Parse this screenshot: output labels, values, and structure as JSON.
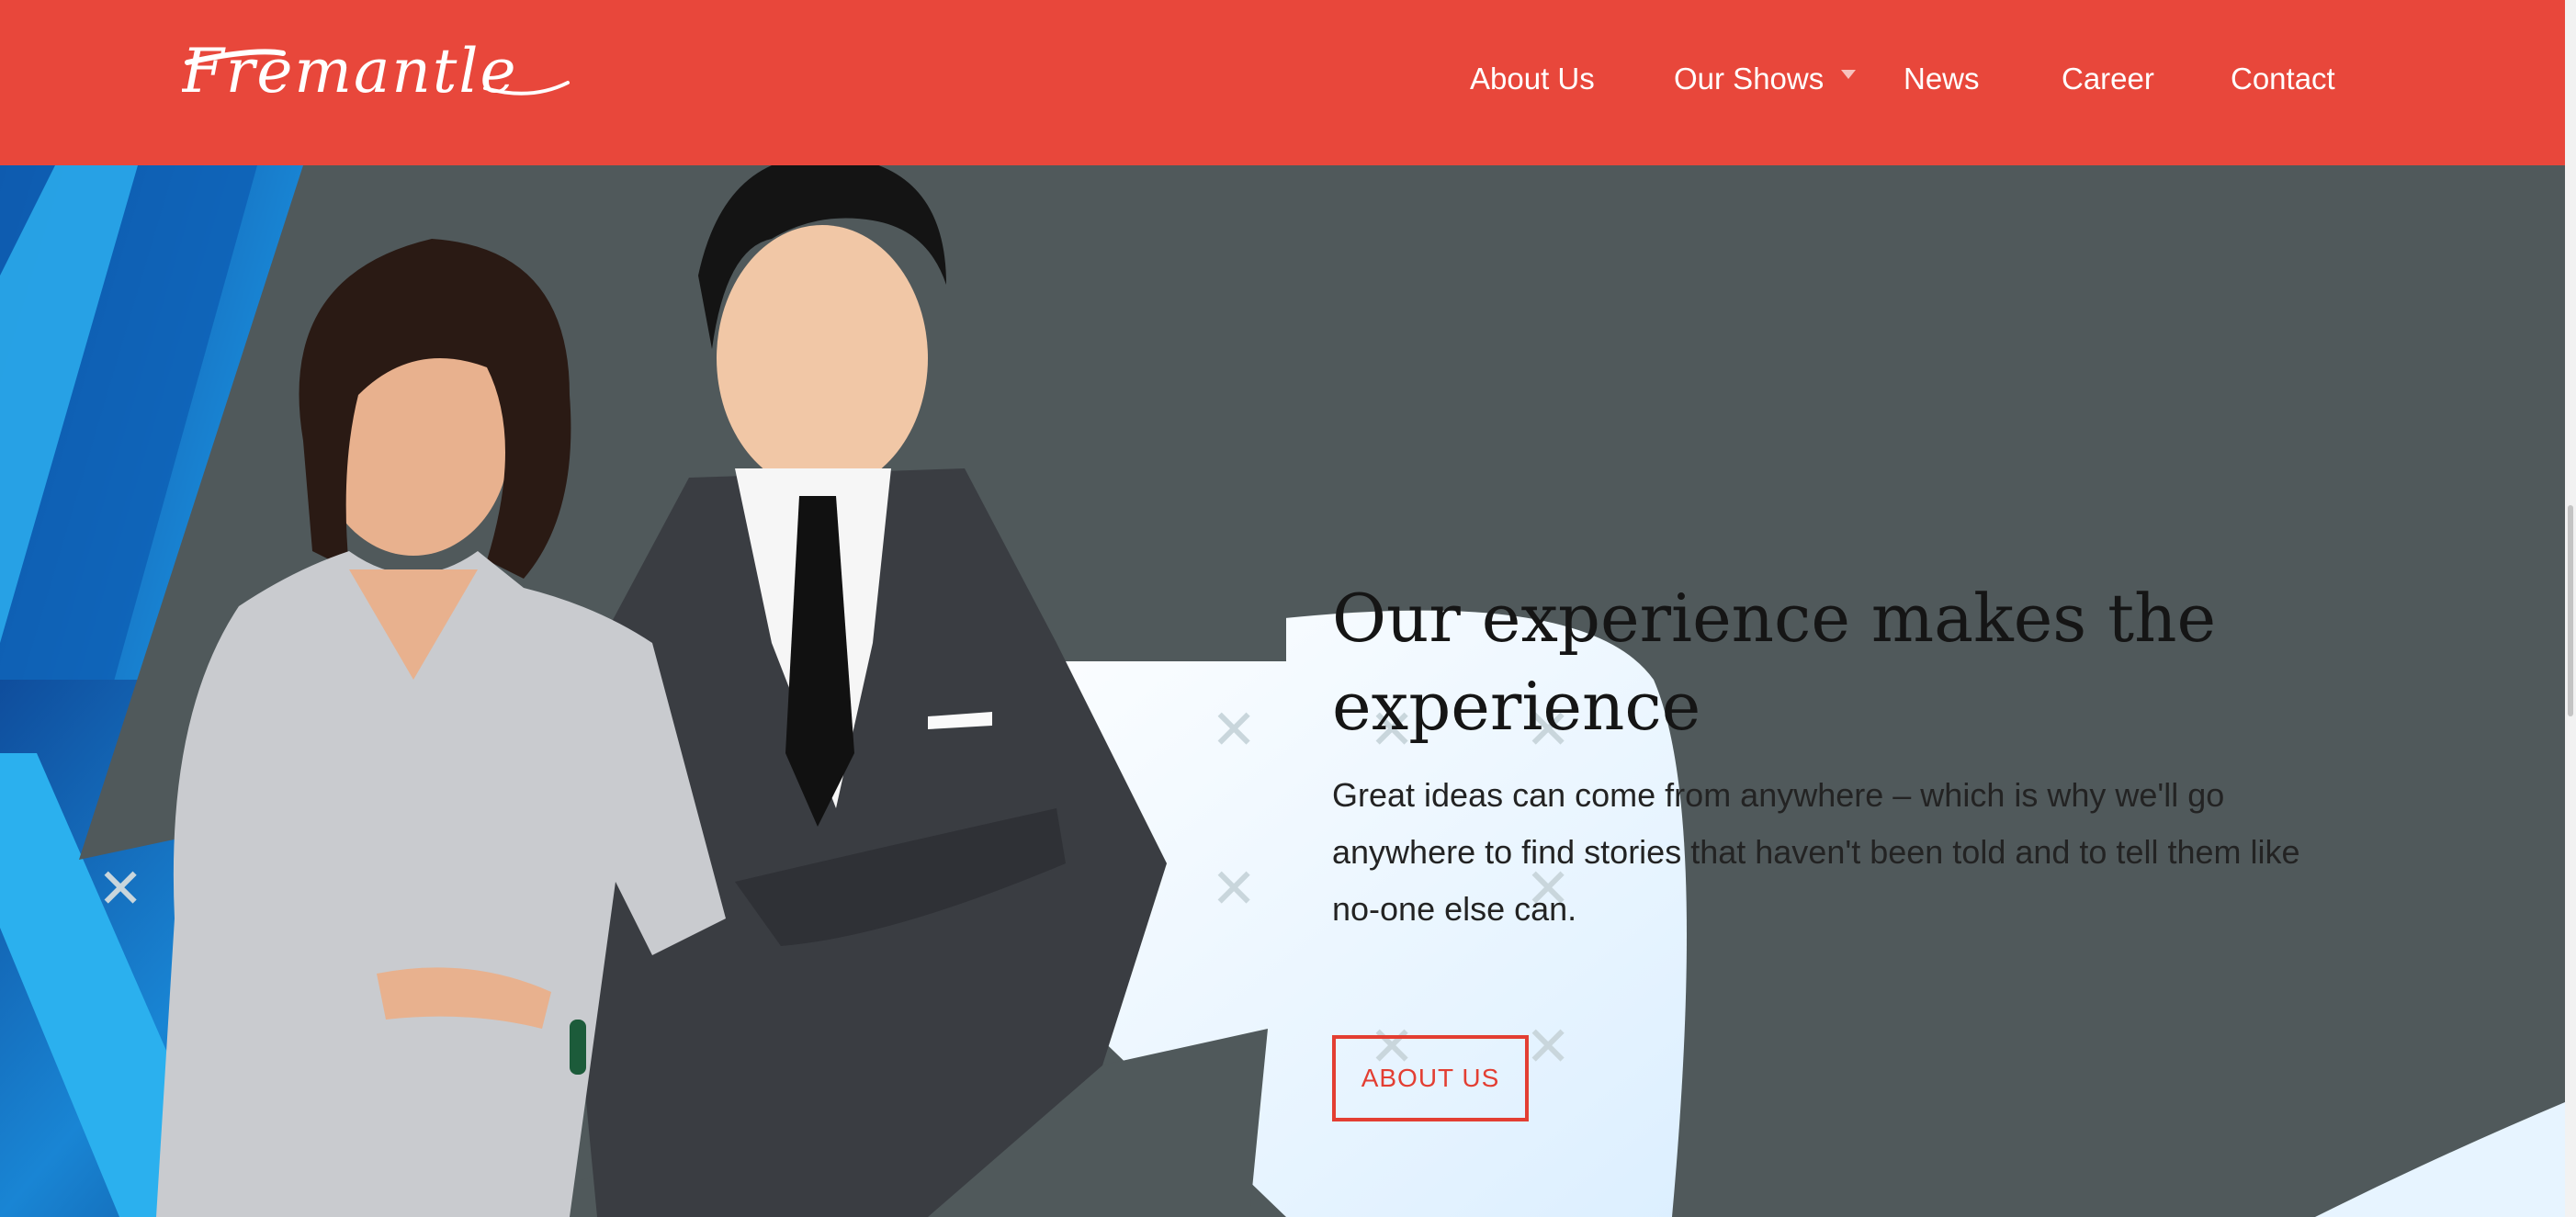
{
  "header": {
    "logo_text": "Fremantle",
    "nav": [
      {
        "label": "About Us"
      },
      {
        "label": "Our Shows"
      },
      {
        "label": "News"
      },
      {
        "label": "Career"
      },
      {
        "label": "Contact"
      }
    ]
  },
  "hero": {
    "headline": "Our experience makes the experience",
    "body": "Great ideas can come from anywhere – which is why we'll go anywhere to find stories that haven't been told and to tell them like no-one else can.",
    "cta_label": "ABOUT US"
  },
  "colors": {
    "brand_red": "#e8473b",
    "hero_gray": "#50595b",
    "accent_blue": "#1f8fd6",
    "cta_red": "#e33e32"
  },
  "icons": [
    "chevron-down-icon",
    "close-icon"
  ]
}
